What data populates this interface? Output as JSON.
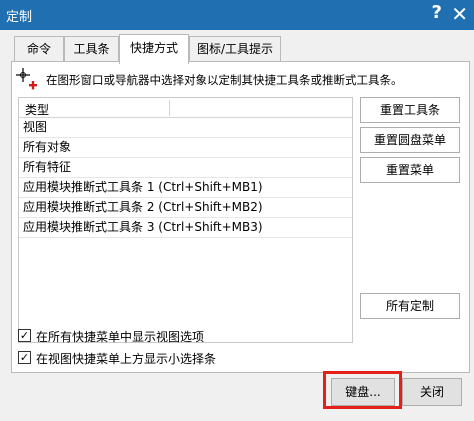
{
  "window": {
    "title": "定制",
    "help_glyph": "?",
    "close_glyph": "✕"
  },
  "tabs": [
    {
      "label": "命令",
      "active": false
    },
    {
      "label": "工具条",
      "active": false
    },
    {
      "label": "快捷方式",
      "active": true
    },
    {
      "label": "图标/工具提示",
      "active": false
    }
  ],
  "hint": {
    "text": "在图形窗口或导航器中选择对象以定制其快捷工具条或推断式工具条。"
  },
  "list": {
    "header": "类型",
    "rows": [
      "视图",
      "所有对象",
      "所有特征",
      "应用模块推断式工具条 1 (Ctrl+Shift+MB1)",
      "应用模块推断式工具条 2 (Ctrl+Shift+MB2)",
      "应用模块推断式工具条 3 (Ctrl+Shift+MB3)"
    ]
  },
  "side_buttons": {
    "reset_toolbar": "重置工具条",
    "reset_radial": "重置圆盘菜单",
    "reset_menu": "重置菜单",
    "customize_all": "所有定制"
  },
  "options": {
    "show_view_options": {
      "label": "在所有快捷菜单中显示视图选项",
      "checked": true
    },
    "show_selection_bar": {
      "label": "在视图快捷菜单上方显示小选择条",
      "checked": true
    }
  },
  "footer": {
    "keyboard": "键盘...",
    "close": "关闭"
  },
  "colors": {
    "titlebar": "#1f6fb1",
    "highlight": "#e32019",
    "cross_accent": "#d11a1a"
  }
}
